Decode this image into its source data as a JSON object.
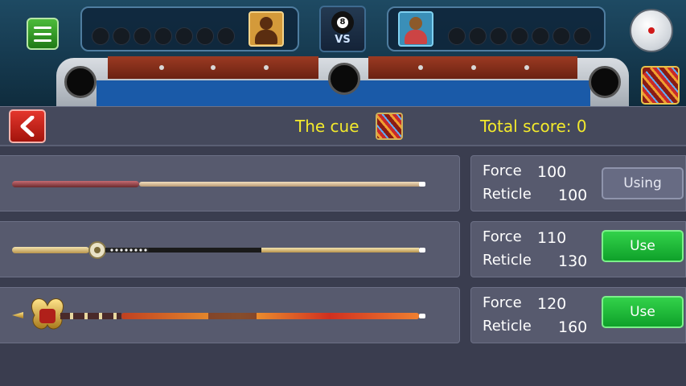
{
  "header": {
    "title": "The cue",
    "total_score_label": "Total score: 0"
  },
  "vs_box": {
    "ball_number": "8",
    "vs_text": "VS"
  },
  "cues": [
    {
      "force_label": "Force",
      "force": "100",
      "reticle_label": "Reticle",
      "reticle": "100",
      "action": "Using",
      "state": "using"
    },
    {
      "force_label": "Force",
      "force": "110",
      "reticle_label": "Reticle",
      "reticle": "130",
      "action": "Use",
      "state": "available"
    },
    {
      "force_label": "Force",
      "force": "120",
      "reticle_label": "Reticle",
      "reticle": "160",
      "action": "Use",
      "state": "available"
    }
  ],
  "colors": {
    "accent_yellow": "#f3ea2c",
    "use_green": "#1fb83a",
    "back_red": "#d42a20",
    "panel": "#575a6e"
  },
  "icons": [
    "menu-icon",
    "eight-ball-icon",
    "avatar-icon",
    "cue-ball-icon",
    "cues-icon",
    "back-arrow-icon"
  ]
}
